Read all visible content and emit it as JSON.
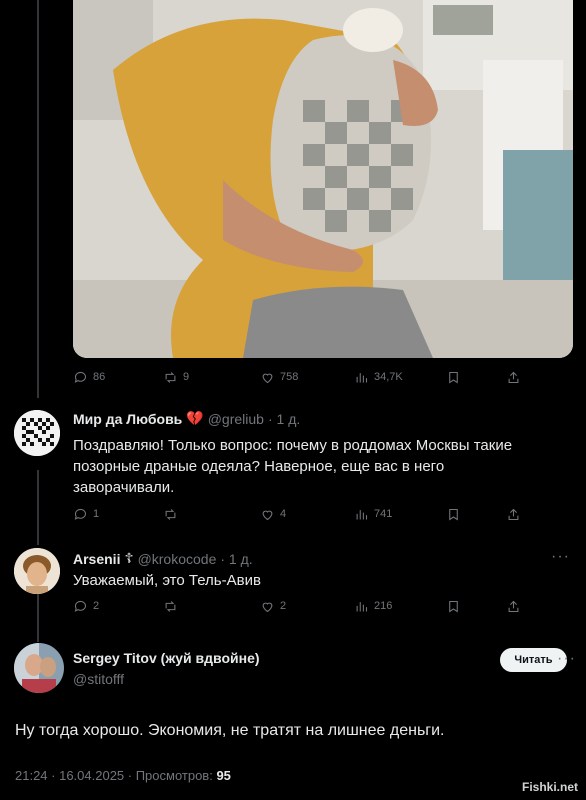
{
  "tweet_photo": {
    "alt": ""
  },
  "photo_actions": {
    "replies": "86",
    "reposts": "9",
    "likes": "758",
    "views": "34,7K"
  },
  "replies": [
    {
      "name": "Мир да Любовь",
      "name_emoji": "💔",
      "handle": "@greliub",
      "time": "· 1 д.",
      "text": "Поздравляю! Только вопрос: почему в роддомах Москвы такие позорные драные одеяла? Наверное, еще вас в него заворачивали.",
      "actions": {
        "replies": "1",
        "reposts": "",
        "likes": "4",
        "views": "741"
      }
    },
    {
      "name": "Arsenii",
      "name_emoji": "☦",
      "handle": "@krokocode",
      "time": "· 1 д.",
      "text": "Уважаемый, это Тель-Авив",
      "actions": {
        "replies": "2",
        "reposts": "",
        "likes": "2",
        "views": "216"
      }
    }
  ],
  "main_tweet": {
    "name": "Sergey Titov (жуй вдвойне)",
    "handle": "@stitofff",
    "follow_label": "Читать",
    "text": "Ну тогда хорошо. Экономия, не тратят на лишнее деньги.",
    "timestamp": "21:24 · 16.04.2025 · Просмотров: ",
    "views": "95"
  },
  "more_icon_label": "···",
  "watermark": "Fishki.net",
  "colors": {
    "background": "#000000",
    "text": "#e7e9ea",
    "muted": "#71767b",
    "line": "#333639",
    "heart": "#f91880"
  }
}
